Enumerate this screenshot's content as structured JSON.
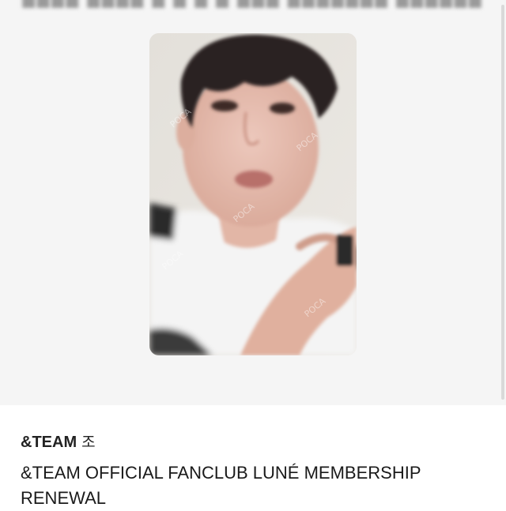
{
  "listing": {
    "artist": "&TEAM",
    "member": "조",
    "title": "&TEAM OFFICIAL FANCLUB LUNÉ MEMBERSHIP RENEWAL"
  },
  "image": {
    "watermark": "POCA",
    "background_color": "#f5f5f5"
  }
}
